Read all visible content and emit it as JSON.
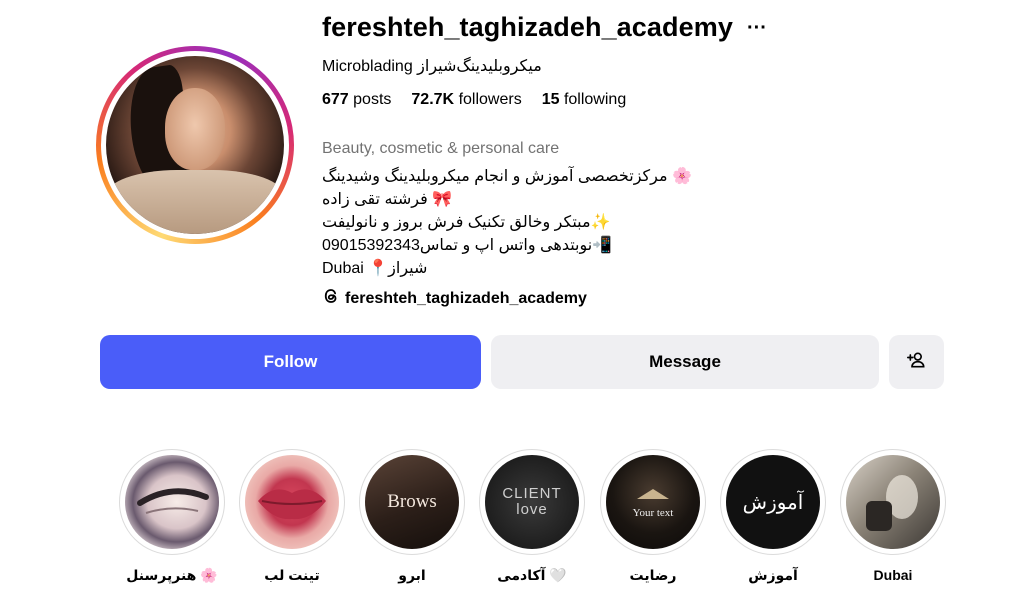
{
  "profile": {
    "username": "fereshteh_taghizadeh_academy",
    "more_label": "···",
    "subtitle": "Microblading میکروبلیدینگ‌شیراز",
    "stats": {
      "posts_count": "677",
      "posts_label": "posts",
      "followers_count": "72.7K",
      "followers_label": "followers",
      "following_count": "15",
      "following_label": "following"
    },
    "category": "Beauty, cosmetic & personal care",
    "bio": [
      "مرکزتخصصی آموزش و انجام میکروبلیدینگ وشیدینگ 🌸",
      "فرشته تقی زاده 🎀",
      "مبتکر وخالق تکنیک فرش بروز و نانولیفت✨",
      "نوبتدهی واتس اپ و تماس09015392343📲",
      "Dubai 📍شیراز"
    ],
    "threads_handle": "fereshteh_taghizadeh_academy"
  },
  "actions": {
    "follow_label": "Follow",
    "message_label": "Message"
  },
  "highlights": [
    {
      "label": "هنرپرسنل 🌸",
      "cover_text": ""
    },
    {
      "label": "تینت لب",
      "cover_text": ""
    },
    {
      "label": "ابرو",
      "cover_text": "Brows"
    },
    {
      "label": "آکادمی 🤍",
      "cover_text": "CLIENT love"
    },
    {
      "label": "رضایت",
      "cover_text": "Your text"
    },
    {
      "label": "آموزش",
      "cover_text": "آموزش"
    },
    {
      "label": "Dubai",
      "cover_text": ""
    }
  ],
  "colors": {
    "follow_button": "#4a5df9",
    "secondary_button": "#efeff2",
    "muted_text": "#737373"
  },
  "icons": {
    "more": "more-options-icon",
    "threads": "threads-icon",
    "add_user": "add-user-icon"
  }
}
